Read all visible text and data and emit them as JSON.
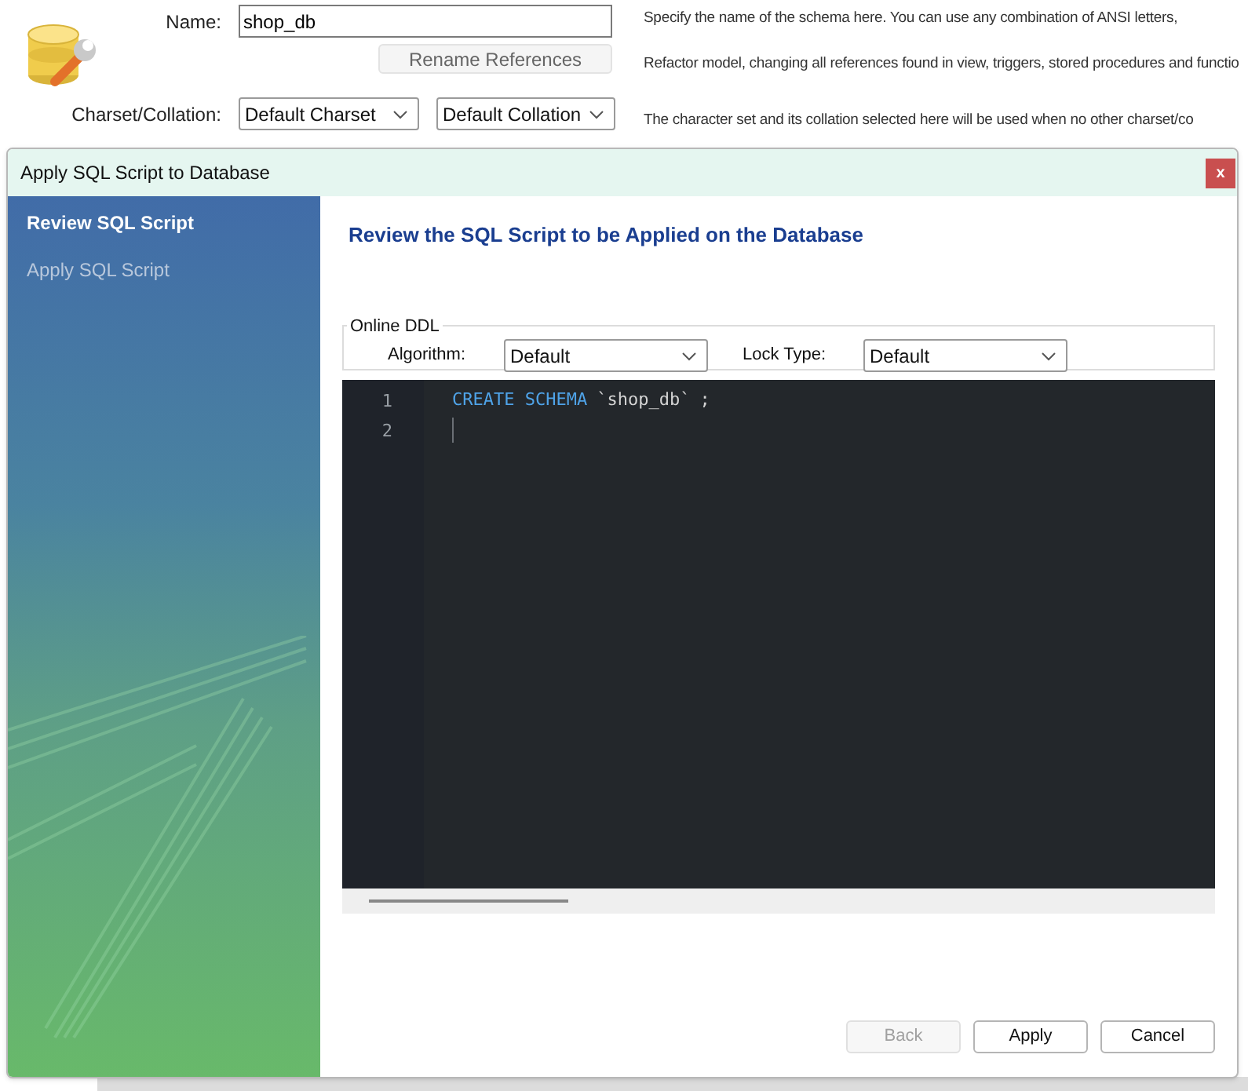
{
  "schema_form": {
    "name_label": "Name:",
    "name_value": "shop_db",
    "rename_button": "Rename References",
    "charset_label": "Charset/Collation:",
    "charset": "Default Charset",
    "collation": "Default Collation",
    "descriptions": [
      "Specify the name of the schema here. You can use any combination of ANSI letters,",
      "Refactor model, changing all references found in view, triggers, stored procedures and functio",
      "The character set and its collation selected here will be used when no other charset/co"
    ]
  },
  "dialog": {
    "title": "Apply SQL Script to Database",
    "close": "x",
    "steps": [
      {
        "label": "Review SQL Script",
        "selected": true
      },
      {
        "label": "Apply SQL Script",
        "selected": false
      }
    ],
    "heading": "Review the SQL Script to be Applied on the Database",
    "online_ddl": {
      "legend": "Online DDL",
      "algorithm_label": "Algorithm:",
      "algorithm": "Default",
      "lock_label": "Lock Type:",
      "lock": "Default"
    },
    "editor": {
      "lines": [
        {
          "number": "1",
          "tokens": [
            {
              "kind": "keyword",
              "text": "CREATE SCHEMA"
            },
            {
              "kind": "identifier",
              "text": "`shop_db`"
            },
            {
              "kind": "punctuation",
              "text": ";"
            }
          ]
        },
        {
          "number": "2",
          "cursor": true
        }
      ]
    },
    "buttons": [
      {
        "label": "Back",
        "disabled": true
      },
      {
        "label": "Apply",
        "disabled": false
      },
      {
        "label": "Cancel",
        "disabled": false
      }
    ]
  }
}
